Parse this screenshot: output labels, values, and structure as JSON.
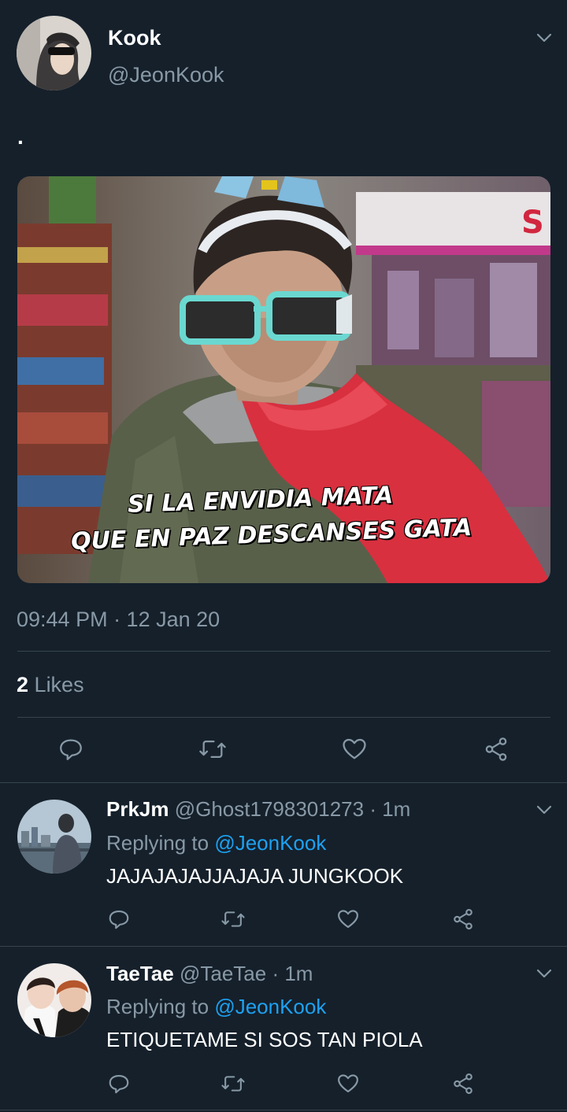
{
  "tweet": {
    "display_name": "Kook",
    "handle": "@JeonKook",
    "text": ".",
    "meme_caption_line1": "SI LA ENVIDIA MATA",
    "meme_caption_line2": "QUE EN PAZ DESCANSES GATA",
    "timestamp": "09:44 PM · 12 Jan 20",
    "likes_count": "2",
    "likes_label": "Likes"
  },
  "replies": [
    {
      "display_name": "PrkJm",
      "handle": "@Ghost1798301273",
      "time": "· 1m",
      "replying_prefix": "Replying to",
      "replying_handle": "@JeonKook",
      "text": "JAJAJAJAJJAJAJA JUNGKOOK"
    },
    {
      "display_name": "TaeTae",
      "handle": "@TaeTae",
      "time": "· 1m",
      "replying_prefix": "Replying to",
      "replying_handle": "@JeonKook",
      "text": "ETIQUETAME SI SOS TAN PIOLA"
    }
  ],
  "icons": {
    "reply": "reply-icon",
    "retweet": "retweet-icon",
    "like": "heart-icon",
    "share": "share-icon",
    "more": "chevron-down-icon"
  },
  "colors": {
    "background": "#15202b",
    "muted": "#8899a6",
    "link": "#1da1f2",
    "divider": "#38444d"
  }
}
